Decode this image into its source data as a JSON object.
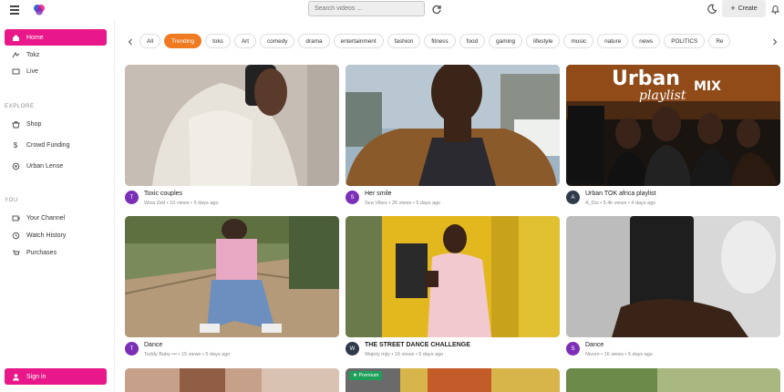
{
  "header": {
    "search_placeholder": "Search videos ...",
    "create_label": "Create"
  },
  "sidebar": {
    "main": [
      {
        "label": "Home",
        "icon": "home-icon",
        "active": true
      },
      {
        "label": "Tokz",
        "icon": "tokz-icon"
      },
      {
        "label": "Live",
        "icon": "live-icon"
      }
    ],
    "explore_title": "EXPLORE",
    "explore": [
      {
        "label": "Shop",
        "icon": "shop-icon"
      },
      {
        "label": "Crowd Funding",
        "icon": "dollar-icon"
      },
      {
        "label": "Urban Lense",
        "icon": "lens-icon"
      }
    ],
    "you_title": "YOU",
    "you": [
      {
        "label": "Your Channel",
        "icon": "channel-icon"
      },
      {
        "label": "Watch History",
        "icon": "history-icon"
      },
      {
        "label": "Purchases",
        "icon": "purchase-icon"
      }
    ],
    "signin_label": "Sign in"
  },
  "chips": [
    "All",
    "Trending",
    "toks",
    "Art",
    "comedy",
    "drama",
    "entertainment",
    "fashion",
    "fitness",
    "food",
    "gaming",
    "lifestyle",
    "music",
    "nature",
    "news",
    "POLITICS",
    "Re"
  ],
  "active_chip": "Trending",
  "videos": [
    {
      "title": "Toxic couples",
      "sub": "Wiza Zed • 10 views • 5 days ago",
      "avatar": "T",
      "avatar_color": "#7b2fb5"
    },
    {
      "title": "Her smile",
      "sub": "Sea Vibes • 26 views • 5 days ago",
      "avatar": "S",
      "avatar_color": "#7b2fb5"
    },
    {
      "title": "Urban TOK africa playlist",
      "sub": "A_Dzi • 5.4k views • 4 days ago",
      "avatar": "A",
      "avatar_color": "#2f3a4a"
    },
    {
      "title": "Dance",
      "sub": "Teddy Baby ••• • 15 views • 5 days ago",
      "avatar": "T",
      "avatar_color": "#7b2fb5"
    },
    {
      "title": "THE STREET DANCE CHALLENGE",
      "sub": "Wajoty mjiy • 16 views • 5 days ago",
      "avatar": "W",
      "avatar_color": "#2f3a4a"
    },
    {
      "title": "Dance",
      "sub": "Nivum • 16 views • 5 days ago",
      "avatar": "S",
      "avatar_color": "#7b2fb5"
    }
  ],
  "thumbnail_art": {
    "title_line1": "Urban",
    "title_line2": "playlist",
    "title_line3": "MIX"
  },
  "premium_label": "Premium",
  "colors": {
    "brand": "#e8188a",
    "chip_active": "#f07a22",
    "premium": "#1fa05a"
  }
}
